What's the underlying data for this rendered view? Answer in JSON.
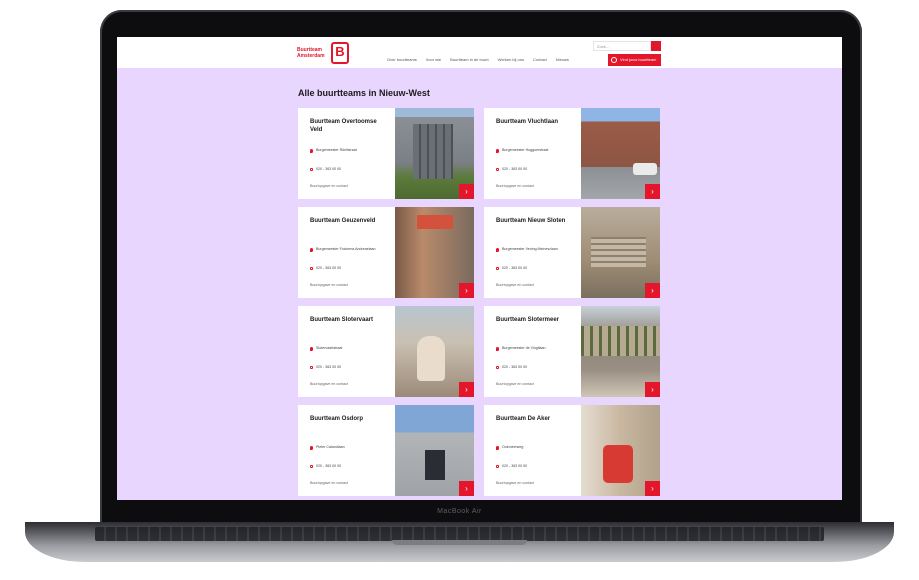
{
  "device": {
    "label": "MacBook Air"
  },
  "header": {
    "logo_text": "Buurtteam Amsterdam",
    "logo_mark": "B",
    "search_placeholder": "Zoek...",
    "nav": [
      "Over buurtteams",
      "Voor wie",
      "Buurtteam in de buurt",
      "Werken bij ons",
      "Contact",
      "Nieuws"
    ],
    "cta_label": "Vind jouw buurtteam"
  },
  "page": {
    "title": "Alle buurtteams in Nieuw-West",
    "cards": [
      {
        "name": "Buurtteam Overtoomse Veld",
        "address": "Burgemeester Röellstraat",
        "phone": "020 - 363 00 00",
        "link": "Buurtopgave en contact",
        "photo": "building-photo"
      },
      {
        "name": "Buurtteam Vluchtlaan",
        "address": "Burgemeester Hogguerstraat",
        "phone": "020 - 363 00 00",
        "link": "Buurtopgave en contact",
        "photo": "brick-building-photo"
      },
      {
        "name": "Buurtteam Geuzenveld",
        "address": "Burgemeester Fockema Andreaelaan",
        "phone": "020 - 363 00 00",
        "link": "Buurtopgave en contact",
        "photo": "street-photo"
      },
      {
        "name": "Buurtteam Nieuw Sloten",
        "address": "Burgemeester Vening Meineszlaan",
        "phone": "020 - 363 00 00",
        "link": "Buurtopgave en contact",
        "photo": "facade-photo"
      },
      {
        "name": "Buurtteam Slotervaart",
        "address": "Slotervaartstraat",
        "phone": "020 - 363 00 00",
        "link": "Buurtopgave en contact",
        "photo": "person-photo"
      },
      {
        "name": "Buurtteam Slotermeer",
        "address": "Burgemeester de Vlugtlaan",
        "phone": "020 - 363 00 00",
        "link": "Buurtopgave en contact",
        "photo": "balcony-photo"
      },
      {
        "name": "Buurtteam Osdorp",
        "address": "Pieter Calandlaan",
        "phone": "020 - 363 00 00",
        "link": "Buurtopgave en contact",
        "photo": "storefront-photo"
      },
      {
        "name": "Buurtteam De Aker",
        "address": "Ookmeerweg",
        "phone": "020 - 363 00 00",
        "link": "Buurtopgave en contact",
        "photo": "interior-photo"
      }
    ]
  },
  "icons": {
    "location": "map-pin-icon",
    "phone": "phone-icon",
    "arrow": "arrow-right-icon",
    "search": "search-icon"
  },
  "colors": {
    "accent": "#e3162b",
    "page_bg": "#e8d6ff"
  }
}
